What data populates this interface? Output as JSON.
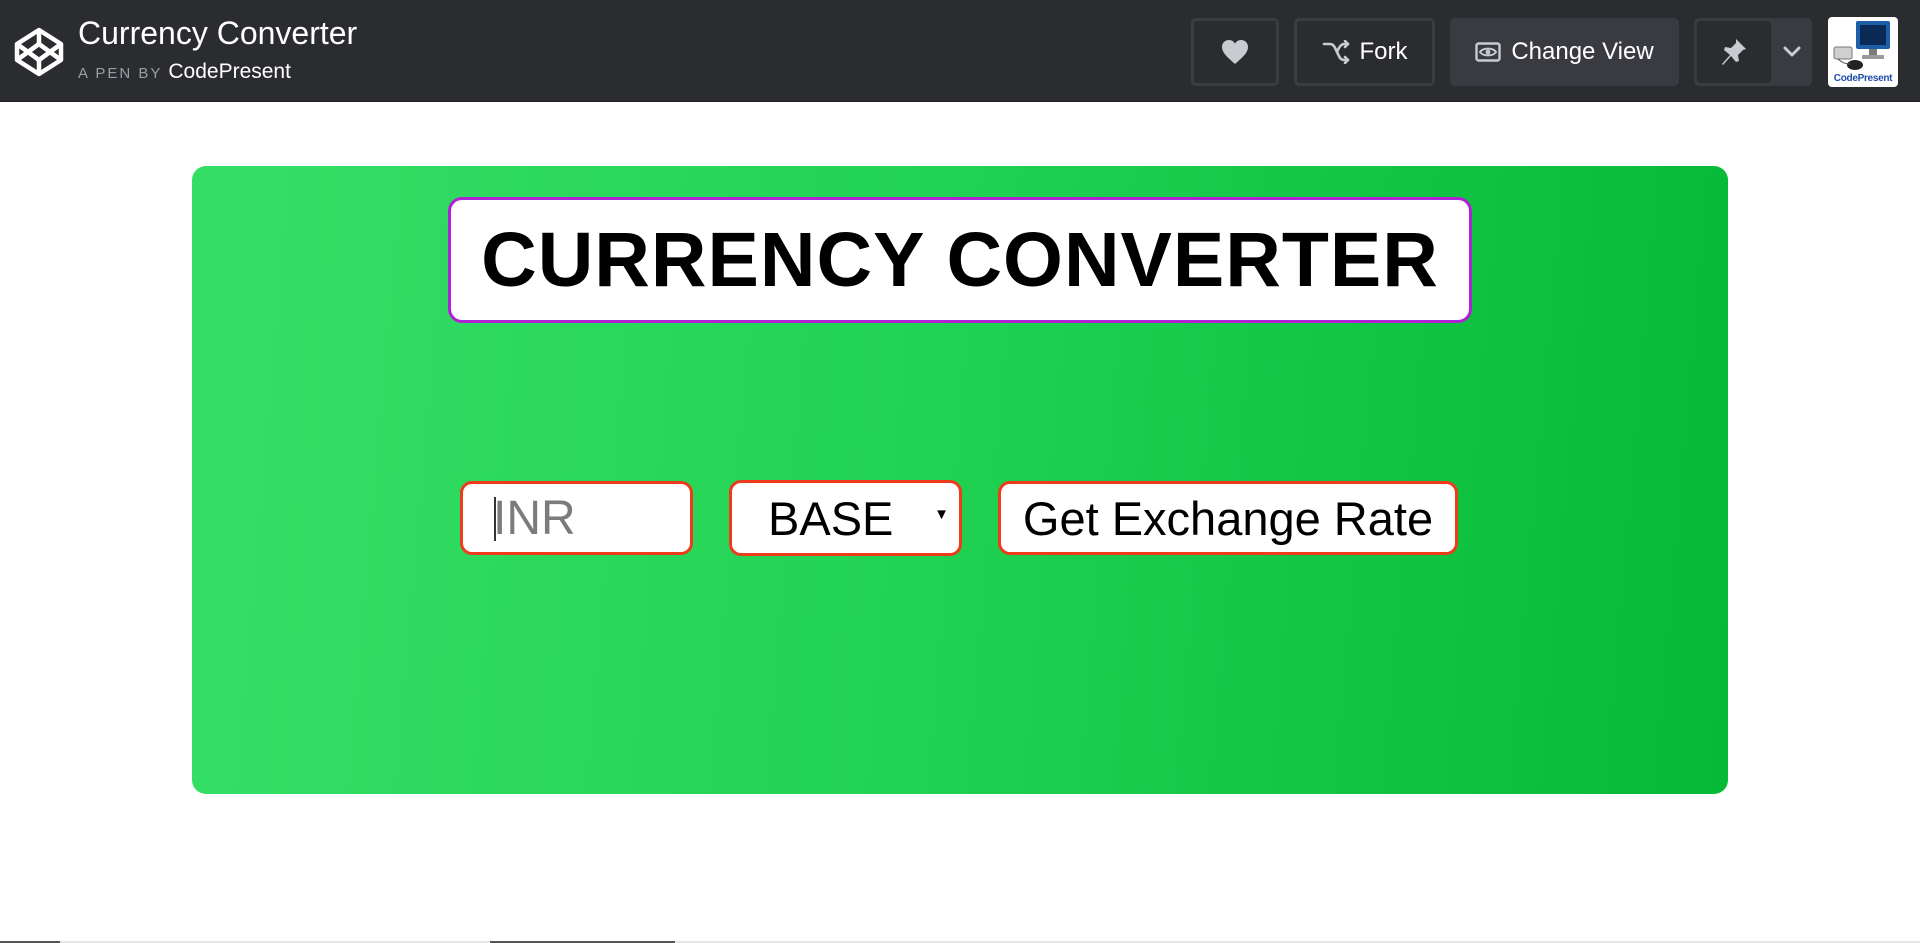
{
  "header": {
    "title": "Currency Converter",
    "byline_prefix": "A PEN BY",
    "author": "CodePresent",
    "avatar_label": "CodePresent",
    "buttons": {
      "heart_icon": "heart-icon",
      "fork_label": "Fork",
      "fork_icon": "fork-icon",
      "change_view_label": "Change View",
      "change_view_icon": "eye-icon",
      "pin_icon": "pin-icon",
      "dropdown_icon": "chevron-down-icon"
    },
    "colors": {
      "bar": "#2b2c2f",
      "button_border": "#3c3d42"
    }
  },
  "converter": {
    "heading": "CURRENCY CONVERTER",
    "amount_placeholder": "INR",
    "amount_value": "",
    "base_select_value": "BASE",
    "button_label": "Get Exchange Rate",
    "colors": {
      "card_start": "#35df66",
      "card_end": "#06b936",
      "heading_border": "#b022d6",
      "control_border": "#ee3b1b"
    }
  }
}
